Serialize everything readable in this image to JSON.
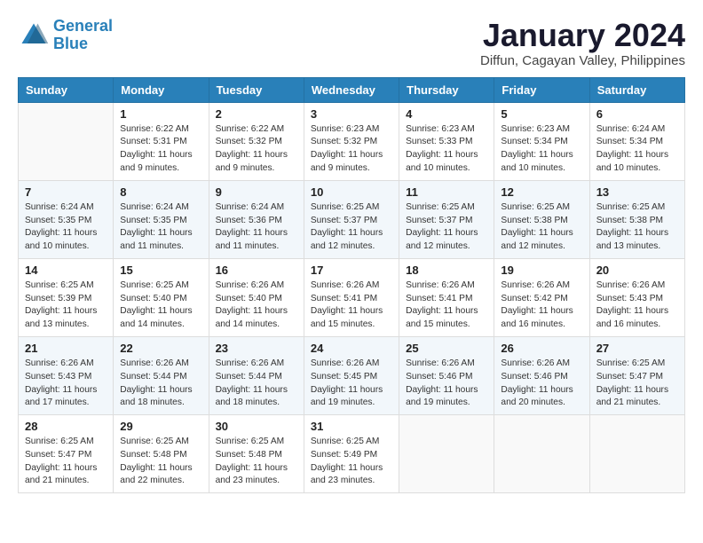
{
  "header": {
    "logo_line1": "General",
    "logo_line2": "Blue",
    "month_title": "January 2024",
    "location": "Diffun, Cagayan Valley, Philippines"
  },
  "weekdays": [
    "Sunday",
    "Monday",
    "Tuesday",
    "Wednesday",
    "Thursday",
    "Friday",
    "Saturday"
  ],
  "weeks": [
    [
      {
        "day": "",
        "sunrise": "",
        "sunset": "",
        "daylight": ""
      },
      {
        "day": "1",
        "sunrise": "Sunrise: 6:22 AM",
        "sunset": "Sunset: 5:31 PM",
        "daylight": "Daylight: 11 hours and 9 minutes."
      },
      {
        "day": "2",
        "sunrise": "Sunrise: 6:22 AM",
        "sunset": "Sunset: 5:32 PM",
        "daylight": "Daylight: 11 hours and 9 minutes."
      },
      {
        "day": "3",
        "sunrise": "Sunrise: 6:23 AM",
        "sunset": "Sunset: 5:32 PM",
        "daylight": "Daylight: 11 hours and 9 minutes."
      },
      {
        "day": "4",
        "sunrise": "Sunrise: 6:23 AM",
        "sunset": "Sunset: 5:33 PM",
        "daylight": "Daylight: 11 hours and 10 minutes."
      },
      {
        "day": "5",
        "sunrise": "Sunrise: 6:23 AM",
        "sunset": "Sunset: 5:34 PM",
        "daylight": "Daylight: 11 hours and 10 minutes."
      },
      {
        "day": "6",
        "sunrise": "Sunrise: 6:24 AM",
        "sunset": "Sunset: 5:34 PM",
        "daylight": "Daylight: 11 hours and 10 minutes."
      }
    ],
    [
      {
        "day": "7",
        "sunrise": "Sunrise: 6:24 AM",
        "sunset": "Sunset: 5:35 PM",
        "daylight": "Daylight: 11 hours and 10 minutes."
      },
      {
        "day": "8",
        "sunrise": "Sunrise: 6:24 AM",
        "sunset": "Sunset: 5:35 PM",
        "daylight": "Daylight: 11 hours and 11 minutes."
      },
      {
        "day": "9",
        "sunrise": "Sunrise: 6:24 AM",
        "sunset": "Sunset: 5:36 PM",
        "daylight": "Daylight: 11 hours and 11 minutes."
      },
      {
        "day": "10",
        "sunrise": "Sunrise: 6:25 AM",
        "sunset": "Sunset: 5:37 PM",
        "daylight": "Daylight: 11 hours and 12 minutes."
      },
      {
        "day": "11",
        "sunrise": "Sunrise: 6:25 AM",
        "sunset": "Sunset: 5:37 PM",
        "daylight": "Daylight: 11 hours and 12 minutes."
      },
      {
        "day": "12",
        "sunrise": "Sunrise: 6:25 AM",
        "sunset": "Sunset: 5:38 PM",
        "daylight": "Daylight: 11 hours and 12 minutes."
      },
      {
        "day": "13",
        "sunrise": "Sunrise: 6:25 AM",
        "sunset": "Sunset: 5:38 PM",
        "daylight": "Daylight: 11 hours and 13 minutes."
      }
    ],
    [
      {
        "day": "14",
        "sunrise": "Sunrise: 6:25 AM",
        "sunset": "Sunset: 5:39 PM",
        "daylight": "Daylight: 11 hours and 13 minutes."
      },
      {
        "day": "15",
        "sunrise": "Sunrise: 6:25 AM",
        "sunset": "Sunset: 5:40 PM",
        "daylight": "Daylight: 11 hours and 14 minutes."
      },
      {
        "day": "16",
        "sunrise": "Sunrise: 6:26 AM",
        "sunset": "Sunset: 5:40 PM",
        "daylight": "Daylight: 11 hours and 14 minutes."
      },
      {
        "day": "17",
        "sunrise": "Sunrise: 6:26 AM",
        "sunset": "Sunset: 5:41 PM",
        "daylight": "Daylight: 11 hours and 15 minutes."
      },
      {
        "day": "18",
        "sunrise": "Sunrise: 6:26 AM",
        "sunset": "Sunset: 5:41 PM",
        "daylight": "Daylight: 11 hours and 15 minutes."
      },
      {
        "day": "19",
        "sunrise": "Sunrise: 6:26 AM",
        "sunset": "Sunset: 5:42 PM",
        "daylight": "Daylight: 11 hours and 16 minutes."
      },
      {
        "day": "20",
        "sunrise": "Sunrise: 6:26 AM",
        "sunset": "Sunset: 5:43 PM",
        "daylight": "Daylight: 11 hours and 16 minutes."
      }
    ],
    [
      {
        "day": "21",
        "sunrise": "Sunrise: 6:26 AM",
        "sunset": "Sunset: 5:43 PM",
        "daylight": "Daylight: 11 hours and 17 minutes."
      },
      {
        "day": "22",
        "sunrise": "Sunrise: 6:26 AM",
        "sunset": "Sunset: 5:44 PM",
        "daylight": "Daylight: 11 hours and 18 minutes."
      },
      {
        "day": "23",
        "sunrise": "Sunrise: 6:26 AM",
        "sunset": "Sunset: 5:44 PM",
        "daylight": "Daylight: 11 hours and 18 minutes."
      },
      {
        "day": "24",
        "sunrise": "Sunrise: 6:26 AM",
        "sunset": "Sunset: 5:45 PM",
        "daylight": "Daylight: 11 hours and 19 minutes."
      },
      {
        "day": "25",
        "sunrise": "Sunrise: 6:26 AM",
        "sunset": "Sunset: 5:46 PM",
        "daylight": "Daylight: 11 hours and 19 minutes."
      },
      {
        "day": "26",
        "sunrise": "Sunrise: 6:26 AM",
        "sunset": "Sunset: 5:46 PM",
        "daylight": "Daylight: 11 hours and 20 minutes."
      },
      {
        "day": "27",
        "sunrise": "Sunrise: 6:25 AM",
        "sunset": "Sunset: 5:47 PM",
        "daylight": "Daylight: 11 hours and 21 minutes."
      }
    ],
    [
      {
        "day": "28",
        "sunrise": "Sunrise: 6:25 AM",
        "sunset": "Sunset: 5:47 PM",
        "daylight": "Daylight: 11 hours and 21 minutes."
      },
      {
        "day": "29",
        "sunrise": "Sunrise: 6:25 AM",
        "sunset": "Sunset: 5:48 PM",
        "daylight": "Daylight: 11 hours and 22 minutes."
      },
      {
        "day": "30",
        "sunrise": "Sunrise: 6:25 AM",
        "sunset": "Sunset: 5:48 PM",
        "daylight": "Daylight: 11 hours and 23 minutes."
      },
      {
        "day": "31",
        "sunrise": "Sunrise: 6:25 AM",
        "sunset": "Sunset: 5:49 PM",
        "daylight": "Daylight: 11 hours and 23 minutes."
      },
      {
        "day": "",
        "sunrise": "",
        "sunset": "",
        "daylight": ""
      },
      {
        "day": "",
        "sunrise": "",
        "sunset": "",
        "daylight": ""
      },
      {
        "day": "",
        "sunrise": "",
        "sunset": "",
        "daylight": ""
      }
    ]
  ]
}
